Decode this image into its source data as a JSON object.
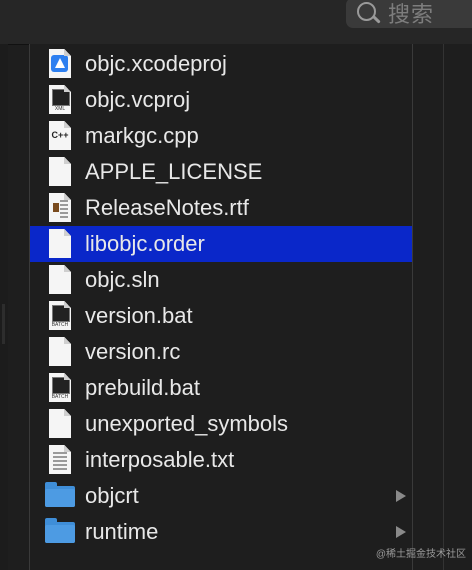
{
  "search": {
    "placeholder": "搜索",
    "icon": "search-icon"
  },
  "files": [
    {
      "name": "objc.xcodeproj",
      "icon": "xcodeproj-file-icon",
      "kind": "doc-blue"
    },
    {
      "name": "objc.vcproj",
      "icon": "xml-file-icon",
      "kind": "doc-xml",
      "badge": "XML"
    },
    {
      "name": "markgc.cpp",
      "icon": "cpp-file-icon",
      "kind": "doc-cpp",
      "badge": "C++"
    },
    {
      "name": "APPLE_LICENSE",
      "icon": "document-icon",
      "kind": "doc"
    },
    {
      "name": "ReleaseNotes.rtf",
      "icon": "rtf-file-icon",
      "kind": "doc-rtf"
    },
    {
      "name": "libobjc.order",
      "icon": "document-icon",
      "kind": "doc",
      "selected": true
    },
    {
      "name": "objc.sln",
      "icon": "document-icon",
      "kind": "doc"
    },
    {
      "name": "version.bat",
      "icon": "batch-file-icon",
      "kind": "doc-batch",
      "badge": "BATCH"
    },
    {
      "name": "version.rc",
      "icon": "document-icon",
      "kind": "doc"
    },
    {
      "name": "prebuild.bat",
      "icon": "batch-file-icon",
      "kind": "doc-batch",
      "badge": "BATCH"
    },
    {
      "name": "unexported_symbols",
      "icon": "document-icon",
      "kind": "doc"
    },
    {
      "name": "interposable.txt",
      "icon": "text-file-icon",
      "kind": "doc-txt"
    },
    {
      "name": "objcrt",
      "icon": "folder-icon",
      "kind": "folder"
    },
    {
      "name": "runtime",
      "icon": "folder-icon",
      "kind": "folder"
    }
  ],
  "watermark": "@稀土掘金技术社区",
  "colors": {
    "selection": "#0a27c9",
    "folder": "#3f8ed8",
    "background": "#1e1e1e"
  }
}
